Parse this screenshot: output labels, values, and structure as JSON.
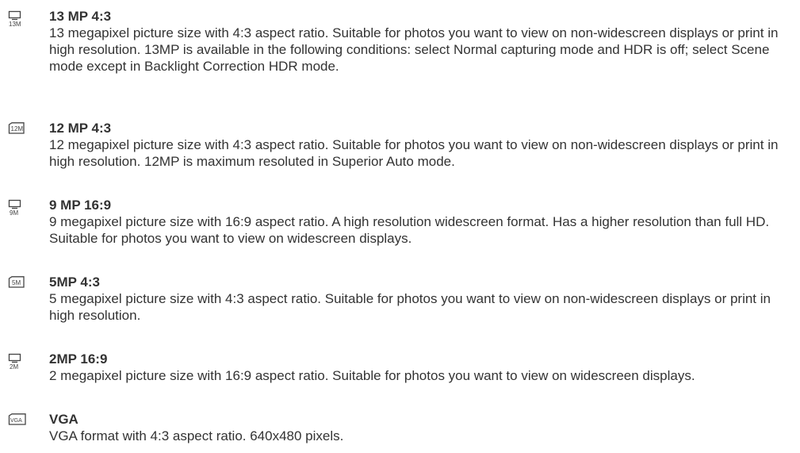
{
  "entries": [
    {
      "icon": "screen-13m-icon",
      "icon_text": "13M",
      "title": "13 MP 4:3",
      "description": "13 megapixel picture size with 4:3 aspect ratio. Suitable for photos you want to view on non-widescreen displays or print in high resolution. 13MP is available in the following conditions: select Normal capturing mode and HDR is off; select Scene mode except in Backlight Correction HDR mode."
    },
    {
      "icon": "frame-12m-icon",
      "icon_text": "12M",
      "title": "12 MP 4:3",
      "description": "12 megapixel picture size with 4:3 aspect ratio. Suitable for photos you want to view on non-widescreen displays or print in high resolution. 12MP is maximum resoluted in Superior Auto mode."
    },
    {
      "icon": "screen-9m-icon",
      "icon_text": "9M",
      "title": "9 MP 16:9",
      "description": "9 megapixel picture size with 16:9 aspect ratio. A high resolution widescreen format. Has a higher resolution than full HD. Suitable for photos you want to view on widescreen displays."
    },
    {
      "icon": "frame-5m-icon",
      "icon_text": "5M",
      "title": "5MP 4:3",
      "description": "5 megapixel picture size with 4:3 aspect ratio. Suitable for photos you want to view on non-widescreen displays or print in high resolution."
    },
    {
      "icon": "screen-2m-icon",
      "icon_text": "2M",
      "title": "2MP 16:9",
      "description": "2 megapixel picture size with 16:9 aspect ratio. Suitable for photos you want to view on widescreen displays."
    },
    {
      "icon": "frame-vga-icon",
      "icon_text": "VGA",
      "title": "VGA",
      "description": "VGA format with 4:3 aspect ratio. 640x480 pixels."
    }
  ]
}
